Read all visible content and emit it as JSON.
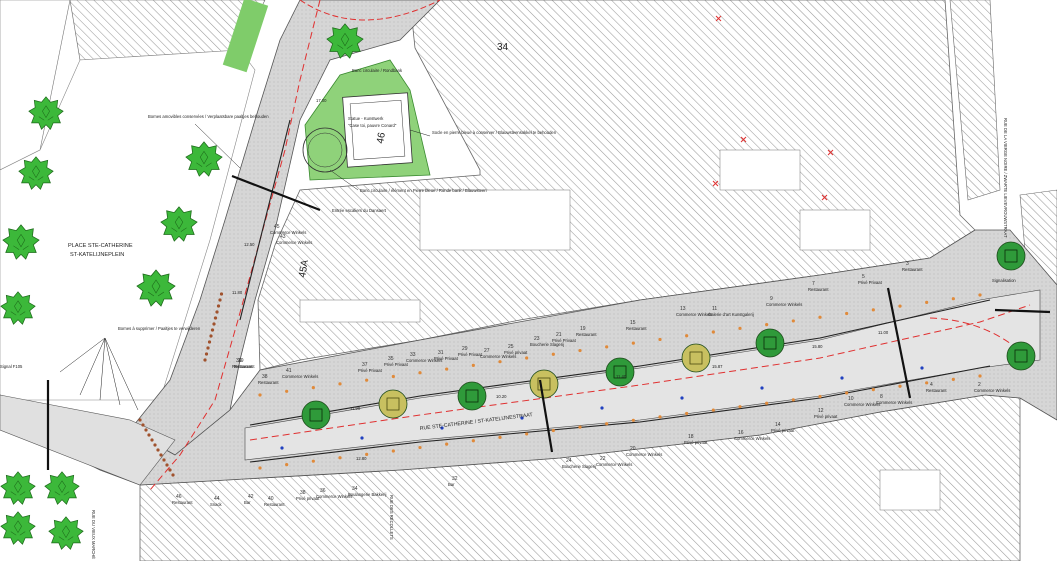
{
  "place": {
    "name_fr": "PLACE STE-CATHERINE",
    "name_nl": "ST-KATELIJNEPLEIN"
  },
  "street_names": {
    "main_street": "RUE STE-CATHERINE / ST-KATELIJNESTRAAT",
    "vieux_marche": "RUE DU VIEUX MARCHÉ",
    "blocks_right": "RUE DE LA VIERGE NOIRE / ZWARTE LIEVEVROUWSTRAAT",
    "bottom_middle": "RUE DES RÉCOLLETS"
  },
  "block_numbers": {
    "b34": "34",
    "b45a": "45A",
    "b46": "46"
  },
  "annotations": {
    "bollards_kept": "Bornes amovibles conservées / Verplaatsbare paaltjes behouden",
    "bollards_remove": "Bornes à supprimer / Paaltjes te verwijderen",
    "statue": "Statue - Kunstwerk",
    "statue_sub": "\"Case toi, pauvre Conard\"",
    "socle": "Socle en pierre bleue à conserver / Blauwsteensokkel te behouden",
    "bench_round": "Banc circulaire / Rondbank",
    "bench_round_stone": "Banc circulaire / élément en Pierre bleue / Ronde bank / Blauwsteen",
    "entry": "Entrée escaliers du Dansaert",
    "pole_left": "Signal F105",
    "pole_right": "Signalisation"
  },
  "uses_top": [
    {
      "n": "43",
      "label": "Commerce Winkels"
    },
    {
      "n": "41",
      "label": "Commerce Winkels"
    },
    {
      "n": "39",
      "label": "Restaurant"
    },
    {
      "n": "37",
      "label": "Privé Privaat"
    },
    {
      "n": "35",
      "label": "Privé Privaat"
    },
    {
      "n": "33",
      "label": "Commerce Winkels"
    },
    {
      "n": "31",
      "label": "Privé Privaat"
    },
    {
      "n": "29",
      "label": "Privé Privaat"
    },
    {
      "n": "27",
      "label": "Commerce Winkels"
    },
    {
      "n": "25",
      "label": "Privé privaat"
    },
    {
      "n": "23",
      "label": "Boucherie Slagerij"
    },
    {
      "n": "21",
      "label": "Privé Privaat"
    },
    {
      "n": "19",
      "label": "Restaurant"
    },
    {
      "n": "15",
      "label": "Restaurant"
    },
    {
      "n": "13",
      "label": "Commerce Winkels"
    },
    {
      "n": "11",
      "label": "Galerie d'art Kunstgalerij"
    },
    {
      "n": "9",
      "label": "Commerce Winkels"
    },
    {
      "n": "7",
      "label": "Restaurant"
    },
    {
      "n": "5",
      "label": "Privé Privaat"
    },
    {
      "n": "3",
      "label": "Restaurant"
    },
    {
      "n": "45",
      "label": "Commerce Winkels"
    },
    {
      "n": "36",
      "label": "Restaurant"
    },
    {
      "n": "38",
      "label": "Restaurant"
    }
  ],
  "uses_bottom": [
    {
      "n": "46",
      "label": "Restaurant"
    },
    {
      "n": "44",
      "label": "Snack"
    },
    {
      "n": "42",
      "label": "Bar"
    },
    {
      "n": "40",
      "label": "Restaurant"
    },
    {
      "n": "38",
      "label": "Privé privaat"
    },
    {
      "n": "36",
      "label": "Commerce Winkels"
    },
    {
      "n": "34",
      "label": "Boulangerie Bakkerij"
    },
    {
      "n": "32",
      "label": "Bar"
    },
    {
      "n": "24",
      "label": "Boucherie Slagerij"
    },
    {
      "n": "22",
      "label": "Commerce Winkels"
    },
    {
      "n": "20",
      "label": "Commerce Winkels"
    },
    {
      "n": "18",
      "label": "Privé privaat"
    },
    {
      "n": "16",
      "label": "Commerce Winkels"
    },
    {
      "n": "14",
      "label": "Privé privaat"
    },
    {
      "n": "12",
      "label": "Privé privaat"
    },
    {
      "n": "10",
      "label": "Commerce Winkels"
    },
    {
      "n": "8",
      "label": "Commerce Winkels"
    },
    {
      "n": "4",
      "label": "Restaurant"
    },
    {
      "n": "2",
      "label": "Commerce Winkels"
    }
  ],
  "dimensions": [
    "17.00",
    "12.50",
    "11.80",
    "11.90",
    "10.20",
    "11.40",
    "15.87",
    "15.80",
    "11.00",
    "12.80"
  ],
  "trees": [
    {
      "kind": "existing",
      "color": "#3cb83a"
    },
    {
      "kind": "planned",
      "color": "#2f9a3a"
    },
    {
      "kind": "planned-yellow",
      "color": "#c8c060"
    }
  ],
  "colors": {
    "road_fill": "#d9d9d9",
    "pavement_fill": "#c5c5c5",
    "plaza_green": "#8fd27a",
    "tree_green": "#2f9a3a",
    "tree_yellow": "#c8c060",
    "axis_red": "#e03030",
    "hatch": "#9a9a9a",
    "marker_orange": "#e08a3a",
    "marker_brown": "#a0522d",
    "marker_blue": "#2040c0"
  }
}
